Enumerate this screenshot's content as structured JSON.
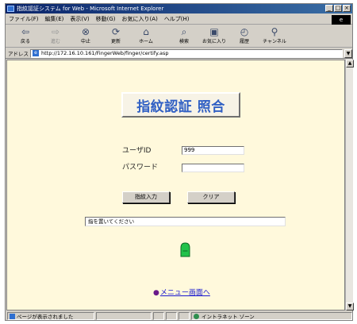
{
  "window": {
    "title": "指紋認証システム for Web - Microsoft Internet Explorer",
    "controls": [
      "_",
      "□",
      "×"
    ]
  },
  "menubar": {
    "items": [
      "ファイル(F)",
      "編集(E)",
      "表示(V)",
      "移動(G)",
      "お気に入り(A)",
      "ヘルプ(H)"
    ]
  },
  "toolbar": {
    "back": "戻る",
    "forward": "進む",
    "stop": "中止",
    "refresh": "更新",
    "home": "ホーム",
    "search": "検索",
    "favorites": "お気に入り",
    "history": "履歴",
    "channels": "チャンネル"
  },
  "address": {
    "label": "アドレス",
    "url": "http://172.16.10.161/FingerWeb/finger/certify.asp"
  },
  "page": {
    "title": "指紋認証 照合",
    "userid_label": "ユーザID",
    "userid_value": "999",
    "password_label": "パスワード",
    "password_value": "",
    "fingerprint_button": "指紋入力",
    "clear_button": "クリア",
    "message": "指を置いてください",
    "menu_link": "メニュー画面へ",
    "menu_link_bullet": "●"
  },
  "statusbar": {
    "status_text": "ページが表示されました",
    "zone_text": "イントラネット ゾーン"
  },
  "colors": {
    "page_background": "#fff9dc",
    "title_text": "#2f5fc4",
    "link": "#1a1ad0",
    "finger_icon": "#21c24a"
  }
}
